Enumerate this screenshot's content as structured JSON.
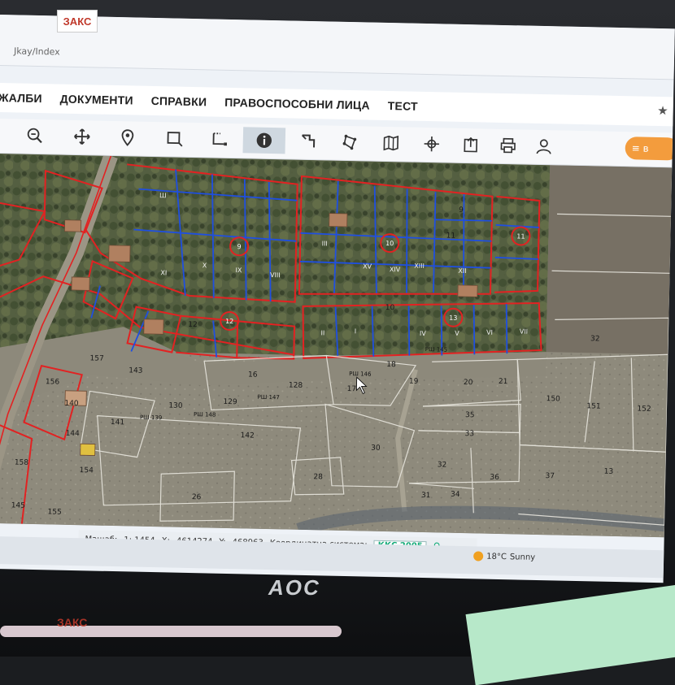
{
  "browser": {
    "url_fragment": "Jkay/Index"
  },
  "logo": {
    "text": "ЗАКС"
  },
  "menu": {
    "items": [
      "ЖАЛБИ",
      "ДОКУМЕНТИ",
      "СПРАВКИ",
      "ПРАВОСПОСОБНИ ЛИЦА",
      "ТЕСТ"
    ]
  },
  "toolbar": {
    "icons": [
      "zoom-out-icon",
      "pan-icon",
      "location-pin-icon",
      "select-rect-icon",
      "select-area-icon",
      "info-icon",
      "measure-icon",
      "polygon-icon",
      "map-layers-icon",
      "coordinates-icon",
      "export-icon",
      "print-icon",
      "user-icon"
    ],
    "right_button_text": "≡ в"
  },
  "map": {
    "parcel_labels": [
      "Ш",
      "XI",
      "IX",
      "VIII",
      "XV",
      "IV",
      "XIII",
      "V",
      "VI",
      "VII",
      "X",
      "XII",
      "XIV",
      "III",
      "II",
      "I"
    ],
    "numbers": [
      "16",
      "17",
      "18",
      "19",
      "20",
      "21",
      "150",
      "151",
      "152",
      "35",
      "33",
      "30",
      "32",
      "36",
      "37",
      "31",
      "34",
      "26",
      "28",
      "142",
      "141",
      "140",
      "156",
      "155",
      "158",
      "154",
      "128",
      "129",
      "130",
      "157",
      "143",
      "144",
      "145",
      "13",
      "10",
      "9",
      "11",
      "12",
      "32"
    ],
    "road_labels": [
      "РШ 145",
      "РШ 146",
      "РШ 147",
      "РШ 148",
      "РШ 139"
    ],
    "circled": [
      "9",
      "10",
      "11",
      "12",
      "13"
    ]
  },
  "status": {
    "scale_label": "Мащаб:",
    "scale_value": "1: 1454",
    "x_label": "X:",
    "x_value": "4614274",
    "y_label": "Y:",
    "y_value": "468963",
    "coord_label": "Координатна система:",
    "coord_value": "ККС 2005"
  },
  "weather": {
    "temp": "18°C",
    "condition": "Sunny"
  },
  "monitor": {
    "brand": "AOC"
  },
  "watermark": {
    "text": "ЗАКС"
  },
  "colors": {
    "parcel_outline": "#e22222",
    "subparcel_outline": "#1f4fe0",
    "menu_text": "#222222",
    "orange": "#f39c3d"
  }
}
